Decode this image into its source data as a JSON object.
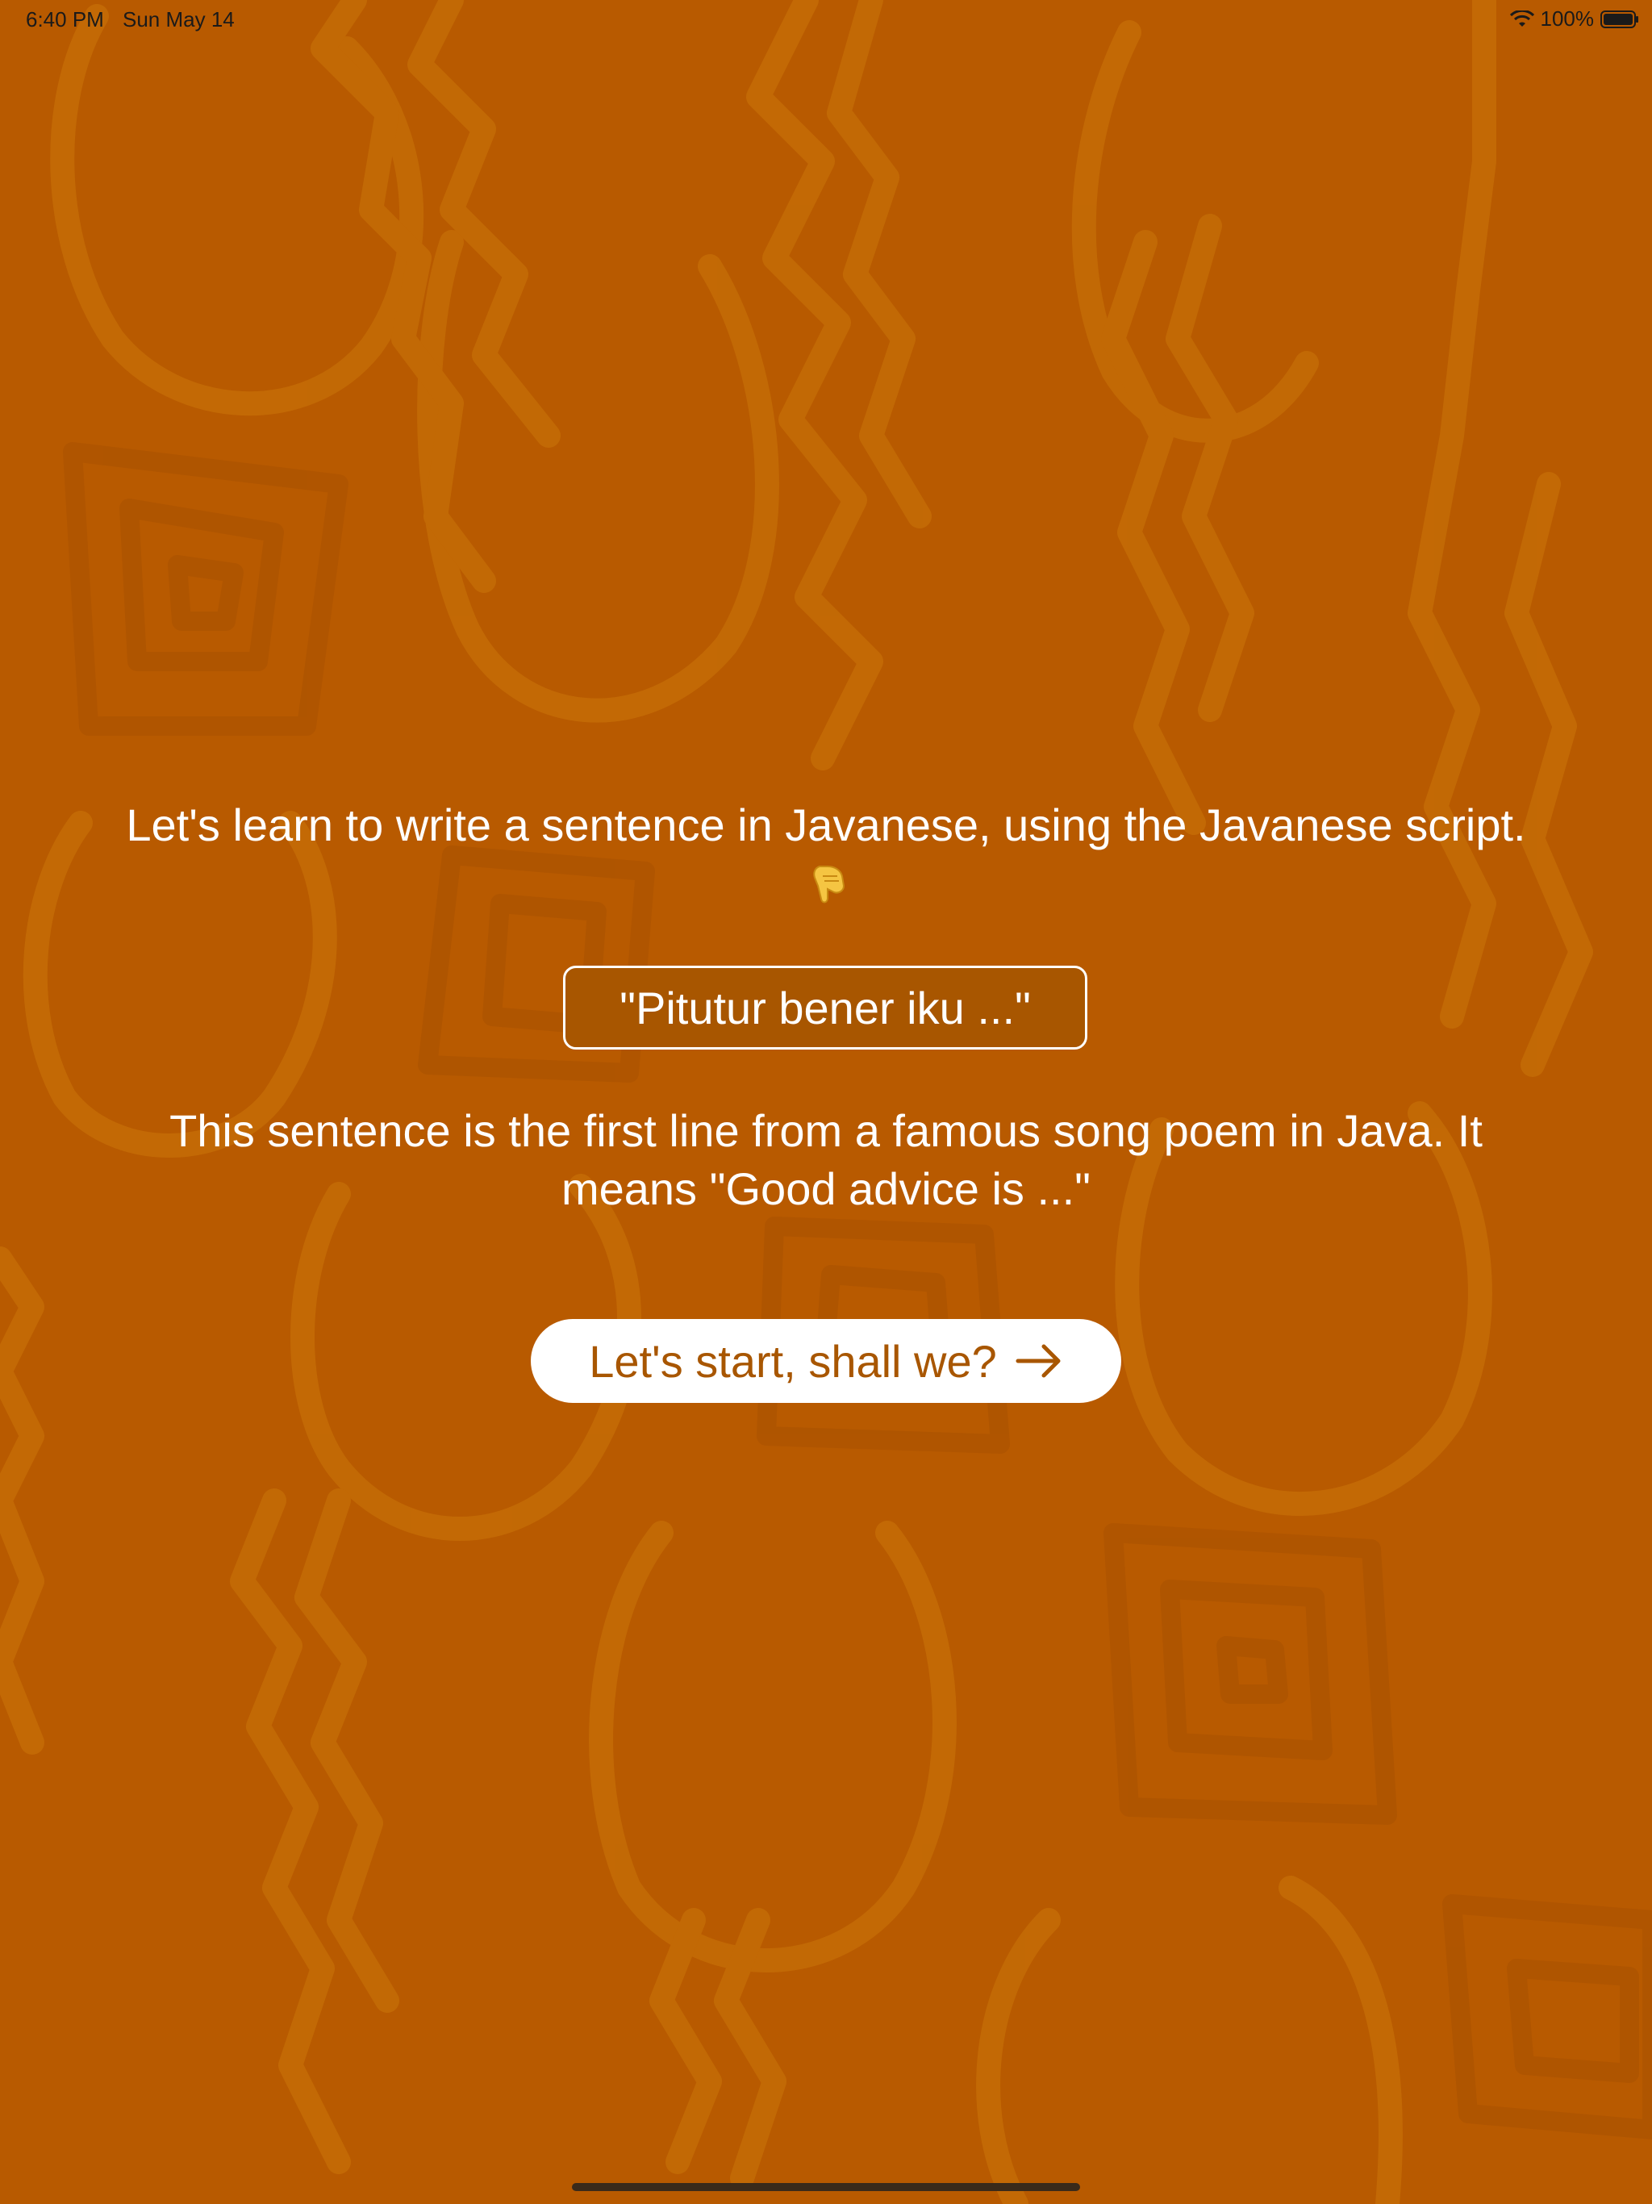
{
  "status_bar": {
    "time": "6:40 PM",
    "date": "Sun May 14",
    "battery_percent": "100%",
    "wifi_icon": "wifi-icon",
    "battery_icon": "battery-full-icon"
  },
  "intro": {
    "text": "Let's learn to write a sentence in Javanese, using the Javanese script.",
    "pointer_icon": "pointing-down-hand-icon"
  },
  "sentence": {
    "text": "\"Pitutur bener iku ...\""
  },
  "explanation": {
    "line1": "This sentence is the first line from a famous song poem in Java. It",
    "line2": "means \"Good advice is ...\""
  },
  "start_button": {
    "label": "Let's start, shall we?",
    "icon": "arrow-right-icon"
  },
  "colors": {
    "background": "#B85A00",
    "pattern": "#C8700A",
    "accent": "#A85600",
    "text": "#FFFFFF"
  }
}
